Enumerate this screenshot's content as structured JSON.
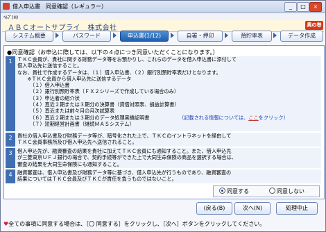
{
  "window": {
    "title": "借入申込書　同意確認（レギュラー）",
    "min": "_",
    "max": "□",
    "close": "×"
  },
  "menu": {
    "help": "ﾍﾙﾌﾟ(H)"
  },
  "header": {
    "company": "ＡＢＣオートサプライ　株式会社",
    "logo": "奥の巻"
  },
  "tabs": [
    {
      "label": "システム概要"
    },
    {
      "label": "パスワード"
    },
    {
      "label": "申込書(1/12)",
      "active": true
    },
    {
      "label": "自署・押印"
    },
    {
      "label": "預貯率表"
    },
    {
      "label": "データ作成"
    }
  ],
  "intro": "●同意確認（お申込に際しては、以下の４点につき同意いただくことになります。）",
  "items": [
    {
      "num": "1",
      "lines": [
        "ＴＫＣ会員が、貴社に関する財務データ等をお預かりし、これらのデータを借入申込書に添付して",
        "借入申込先に送信すること。",
        "なお、貴社で作成するデータは、（１）借入申込書、（２）銀行別預貯率表だけとなります。",
        "　　※ＴＫＣ会員から借入申込先に送信するデータ",
        "　　　（１）借入申込書",
        "　　　（２）銀行別預貯率表（ＦＸ２シリーズで作成している場合のみ）",
        "　　　（３）申込者の紹介状",
        "　　　（４）直近２期または３期分の決算書（貸借対照表、損益計算書）",
        "　　　（５）直近または前々月の月次試算表",
        "　　　（６）直近２期または３期分のデータ処理実績証明書",
        "　　　（７）短期経営計画書（継続ＭＡＳシステム）"
      ],
      "note": "（記載される情報については、",
      "note_link": "ここ",
      "note_end": "をクリック）"
    },
    {
      "num": "2",
      "lines": [
        "貴社の借入申込書及び財務データ等が、暗号化された上で、ＴＫＣのイントラネットを経由して",
        "ＴＫＣ会員事務所及び借入申込先へ送信されること。"
      ]
    },
    {
      "num": "3",
      "lines": [
        "借入申込先が、融資審査の結果を貴社に加えてＴＫＣ会員にも通知すること。また、借入申込先",
        "が三菱東京ＵＦＪ銀行の場合で、契約手続等ができた上で大同生命保険の商品を選択する場合は、",
        "審査の結果を大同生命保険にも通知すること。"
      ]
    },
    {
      "num": "4",
      "lines": [
        "融資審査は、借入申込書及び財務データ等に基づき、借入申込先が行うものであり、融資審査の",
        "結果についてはＴＫＣ会員及びＴＫＣが責任を負うものではないこと。"
      ]
    }
  ],
  "consent": {
    "agree": "同意する",
    "disagree": "同意しない",
    "selected": "agree"
  },
  "buttons": {
    "back": "(戻る(B)",
    "next": "次へ(N)",
    "cancel": "処理中止"
  },
  "footer": {
    "heart": "♥",
    "text": "全ての事項に同意する場合は、［〇 同意する］をクリックし、［次へ］ボタンをクリックしてください。"
  }
}
